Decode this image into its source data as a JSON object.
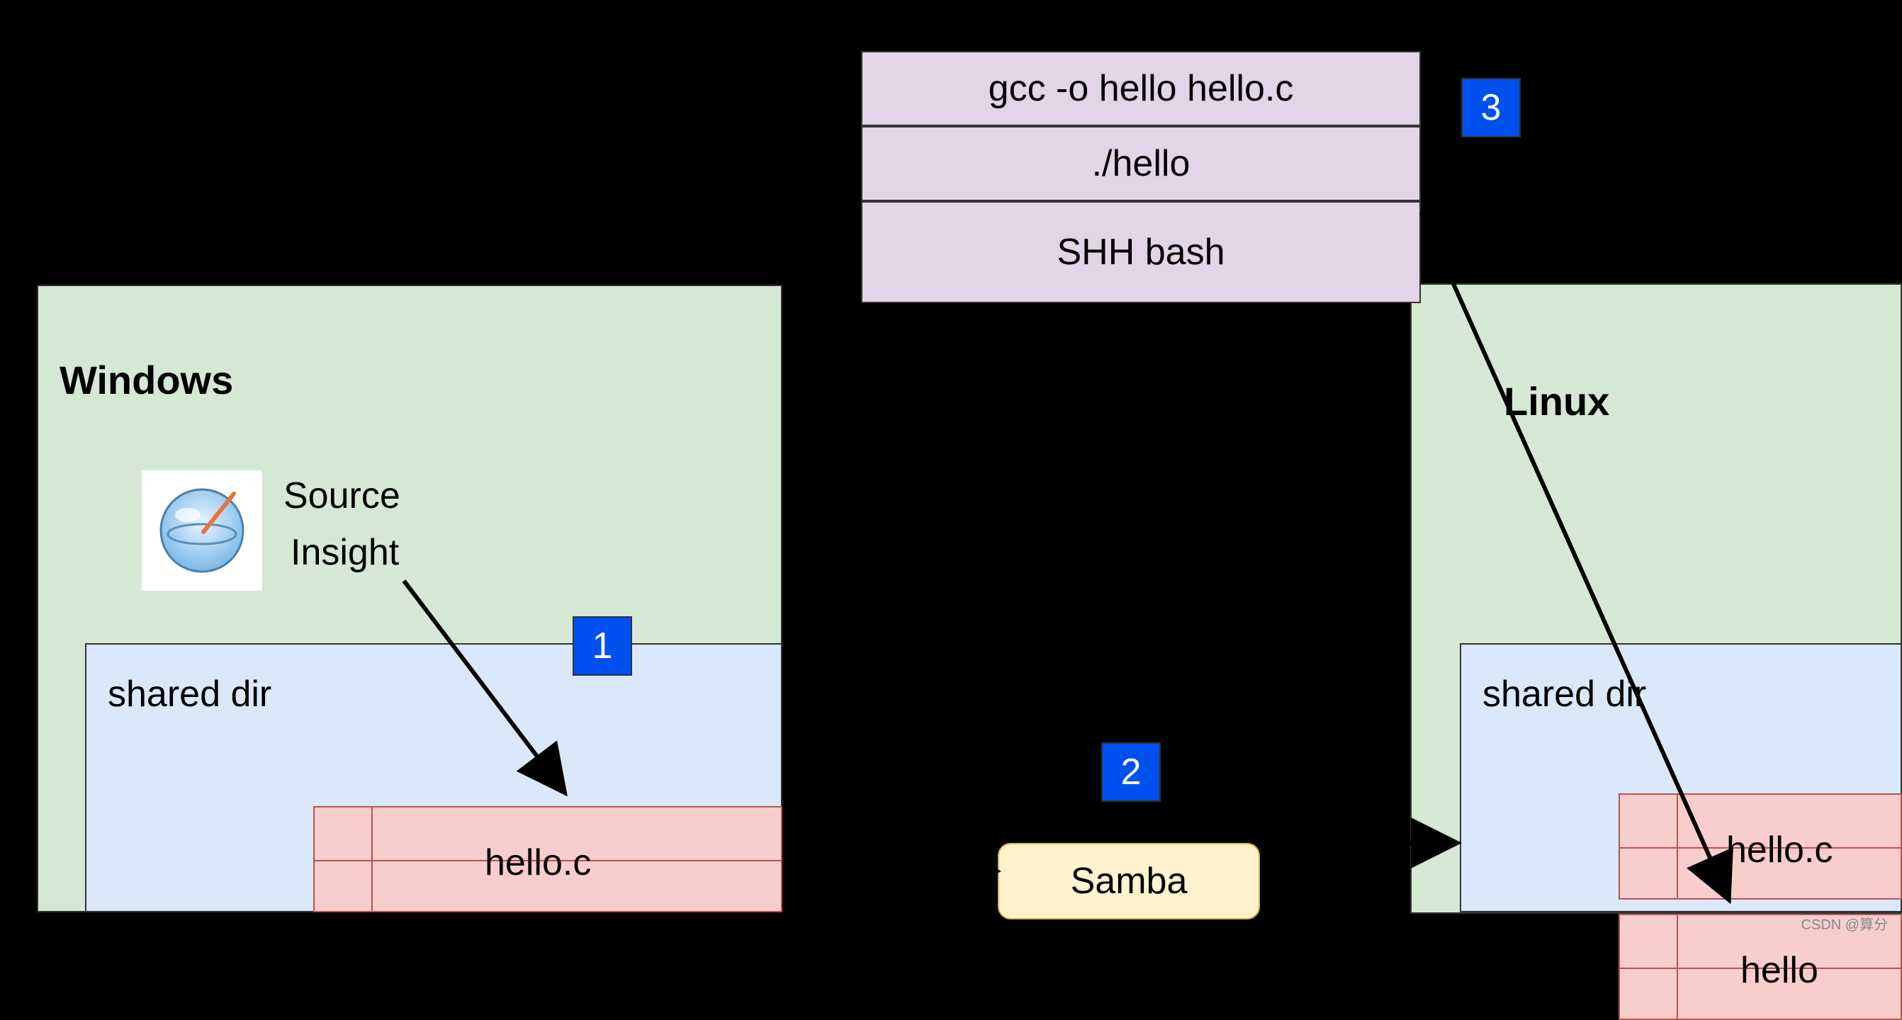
{
  "windows": {
    "title": "Windows",
    "shared_dir_label": "shared dir",
    "source_insight_line1": "Source",
    "source_insight_line2": "Insight",
    "file1": "hello.c"
  },
  "linux": {
    "title": "Linux",
    "shared_dir_label": "shared dir",
    "file1": "hello.c",
    "file2": "hello"
  },
  "commands": {
    "cmd1": "gcc -o hello hello.c",
    "cmd2": "./hello",
    "cmd3": "SHH bash"
  },
  "samba": {
    "label": "Samba"
  },
  "badges": {
    "b1": "1",
    "b2": "2",
    "b3": "3"
  },
  "watermark": "CSDN @算分"
}
